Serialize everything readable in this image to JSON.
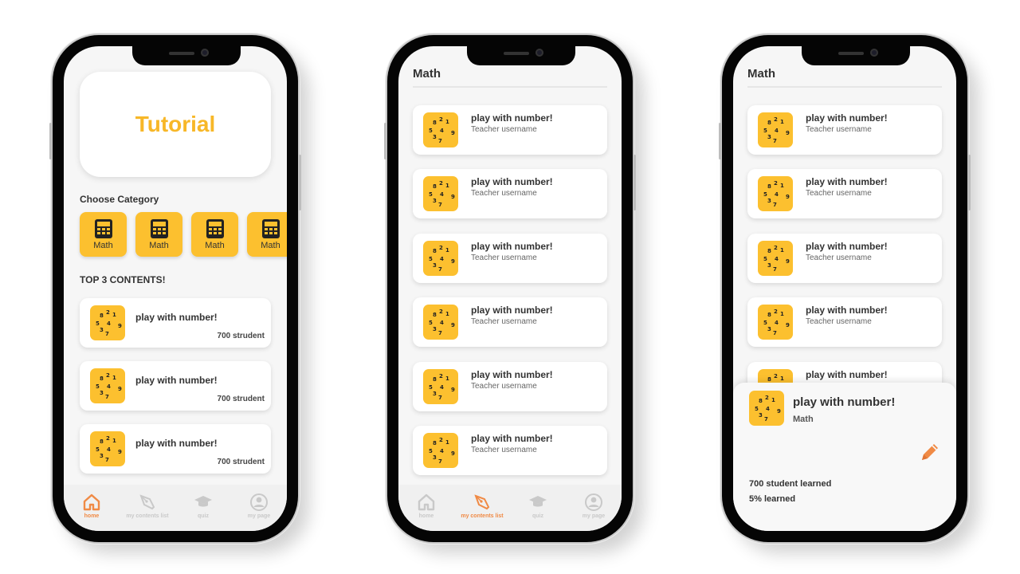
{
  "colors": {
    "accent": "#fcc02f",
    "tutorial_text": "#f7b728",
    "nav_active": "#f08a45",
    "nav_inactive": "#c9c9c9"
  },
  "screen1": {
    "tutorial_title": "Tutorial",
    "choose_category_label": "Choose Category",
    "categories": [
      {
        "label": "Math",
        "icon": "calculator-icon"
      },
      {
        "label": "Math",
        "icon": "calculator-icon"
      },
      {
        "label": "Math",
        "icon": "calculator-icon"
      },
      {
        "label": "Math",
        "icon": "calculator-icon"
      }
    ],
    "top_label": "TOP 3 CONTENTS!",
    "top_contents": [
      {
        "title": "play with number!",
        "count": "700 strudent"
      },
      {
        "title": "play with number!",
        "count": "700 strudent"
      },
      {
        "title": "play with number!",
        "count": "700 strudent"
      }
    ],
    "nav": [
      {
        "label": "home",
        "icon": "home-icon",
        "active": true
      },
      {
        "label": "my contents list",
        "icon": "pen-nib-icon",
        "active": false
      },
      {
        "label": "quiz",
        "icon": "graduation-cap-icon",
        "active": false
      },
      {
        "label": "my page",
        "icon": "user-icon",
        "active": false
      }
    ]
  },
  "screen2": {
    "title": "Math",
    "items": [
      {
        "title": "play with number!",
        "author": "Teacher username"
      },
      {
        "title": "play with number!",
        "author": "Teacher username"
      },
      {
        "title": "play with number!",
        "author": "Teacher username"
      },
      {
        "title": "play with number!",
        "author": "Teacher username"
      },
      {
        "title": "play with number!",
        "author": "Teacher username"
      },
      {
        "title": "play with number!",
        "author": "Teacher username"
      }
    ],
    "nav": [
      {
        "label": "home",
        "icon": "home-icon",
        "active": false
      },
      {
        "label": "my contents list",
        "icon": "pen-nib-icon",
        "active": true
      },
      {
        "label": "quiz",
        "icon": "graduation-cap-icon",
        "active": false
      },
      {
        "label": "my page",
        "icon": "user-icon",
        "active": false
      }
    ]
  },
  "screen3": {
    "title": "Math",
    "items": [
      {
        "title": "play with number!",
        "author": "Teacher username"
      },
      {
        "title": "play with number!",
        "author": "Teacher username"
      },
      {
        "title": "play with number!",
        "author": "Teacher username"
      },
      {
        "title": "play with number!",
        "author": "Teacher username"
      },
      {
        "title": "play with number!",
        "author": ""
      }
    ],
    "sheet": {
      "title": "play with number!",
      "category": "Math",
      "students_learned": "700 student learned",
      "percent_learned": "5% learned",
      "edit_icon": "pencil-icon"
    }
  }
}
